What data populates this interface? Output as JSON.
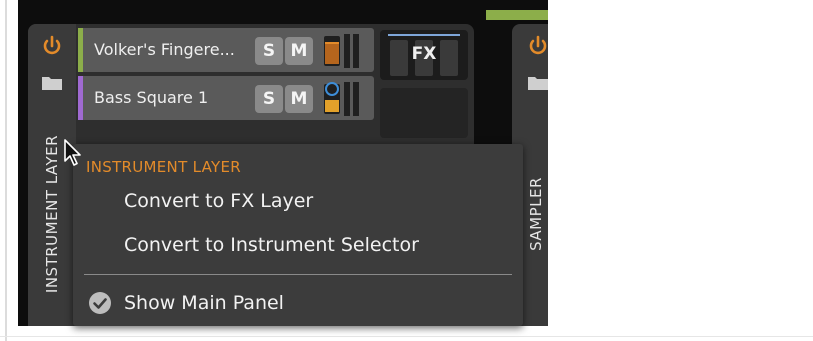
{
  "device": {
    "title": "INSTRUMENT LAYER",
    "layers": [
      {
        "name": "Volker's Fingere...",
        "solo_label": "S",
        "mute_label": "M",
        "color": "#8cae4a"
      },
      {
        "name": "Bass Square 1",
        "solo_label": "S",
        "mute_label": "M",
        "color": "#a06ad2"
      }
    ],
    "fx_label": "FX"
  },
  "next_device": {
    "title": "SAMPLER"
  },
  "context_menu": {
    "header": "INSTRUMENT LAYER",
    "items": [
      {
        "label": "Convert to FX Layer"
      },
      {
        "label": "Convert to Instrument Selector"
      },
      {
        "label": "Show Main Panel",
        "checked": true
      }
    ]
  },
  "colors": {
    "accent_orange": "#e38b2a",
    "meter_blue": "#3e8ed8"
  }
}
